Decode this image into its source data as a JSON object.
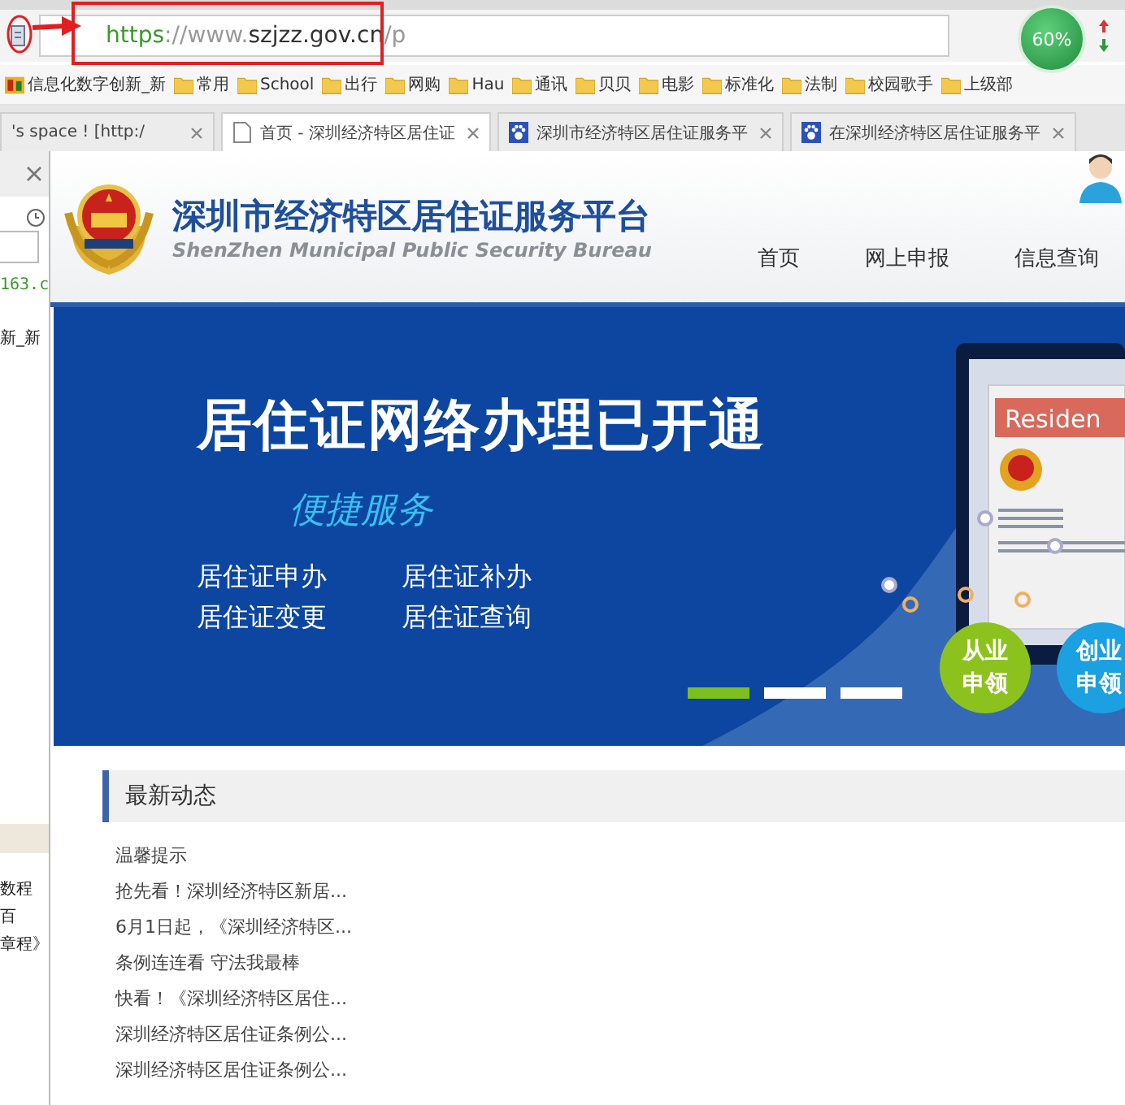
{
  "browser": {
    "address_bar": {
      "url_parts": [
        {
          "text": "https",
          "kind": "scheme"
        },
        {
          "text": "://www.",
          "kind": "dim"
        },
        {
          "text": "szjzz.gov.cn",
          "kind": "host"
        },
        {
          "text": "/p",
          "kind": "dim"
        }
      ]
    },
    "zoom_badge": "60%",
    "bookmarks": [
      {
        "label": "信息化数字创新_新",
        "kind": "page"
      },
      {
        "label": "常用",
        "kind": "folder"
      },
      {
        "label": "School",
        "kind": "folder"
      },
      {
        "label": "出行",
        "kind": "folder"
      },
      {
        "label": "网购",
        "kind": "folder"
      },
      {
        "label": "Hau",
        "kind": "folder"
      },
      {
        "label": "通讯",
        "kind": "folder"
      },
      {
        "label": "贝贝",
        "kind": "folder"
      },
      {
        "label": "电影",
        "kind": "folder"
      },
      {
        "label": "标准化",
        "kind": "folder"
      },
      {
        "label": "法制",
        "kind": "folder"
      },
      {
        "label": "校园歌手",
        "kind": "folder"
      },
      {
        "label": "上级部",
        "kind": "folder"
      }
    ],
    "tabs": [
      {
        "label": "'s space ! [http:/",
        "selected": false
      },
      {
        "label": "首页 - 深圳经济特区居住证",
        "selected": true
      },
      {
        "label": "深圳市经济特区居住证服务平",
        "selected": false
      },
      {
        "label": "在深圳经济特区居住证服务平",
        "selected": false
      }
    ]
  },
  "side_panel": {
    "link": "163.c",
    "items": [
      "新_新"
    ],
    "lower_items": [
      "数程",
      "百",
      "章程》"
    ]
  },
  "site": {
    "title": "深圳市经济特区居住证服务平台",
    "subtitle": "ShenZhen Municipal Public Security Bureau",
    "nav": [
      "首页",
      "网上申报",
      "信息查询"
    ],
    "banner": {
      "headline": "居住证网络办理已开通",
      "tagline": "便捷服务",
      "links": [
        "居住证申办",
        "居住证补办",
        "居住证变更",
        "居住证查询"
      ],
      "card_label": "Residen",
      "badges": [
        {
          "lines": [
            "从业",
            "申领"
          ],
          "color": "#8cc21e"
        },
        {
          "lines": [
            "创业",
            "申领"
          ],
          "color": "#1ba0e2"
        }
      ],
      "slides": [
        {
          "selected": true
        },
        {
          "selected": false
        },
        {
          "selected": false
        }
      ]
    },
    "news": {
      "heading": "最新动态",
      "items": [
        "温馨提示",
        "抢先看！深圳经济特区新居...",
        "6月1日起，《深圳经济特区...",
        "条例连连看 守法我最棒",
        "快看！《深圳经济特区居住...",
        "深圳经济特区居住证条例公...",
        "深圳经济特区居住证条例公..."
      ]
    }
  }
}
